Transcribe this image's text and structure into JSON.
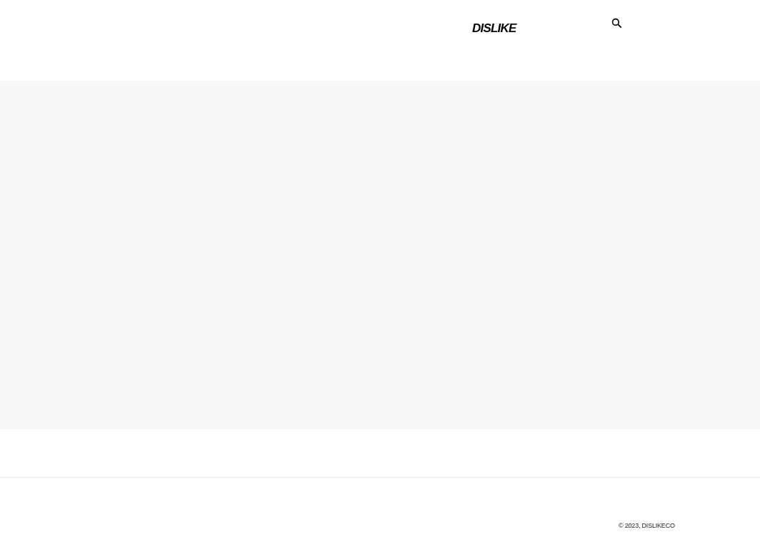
{
  "header": {
    "logo": "DISLIKE"
  },
  "footer": {
    "copyright": "© 2023, DISLIKECO"
  }
}
